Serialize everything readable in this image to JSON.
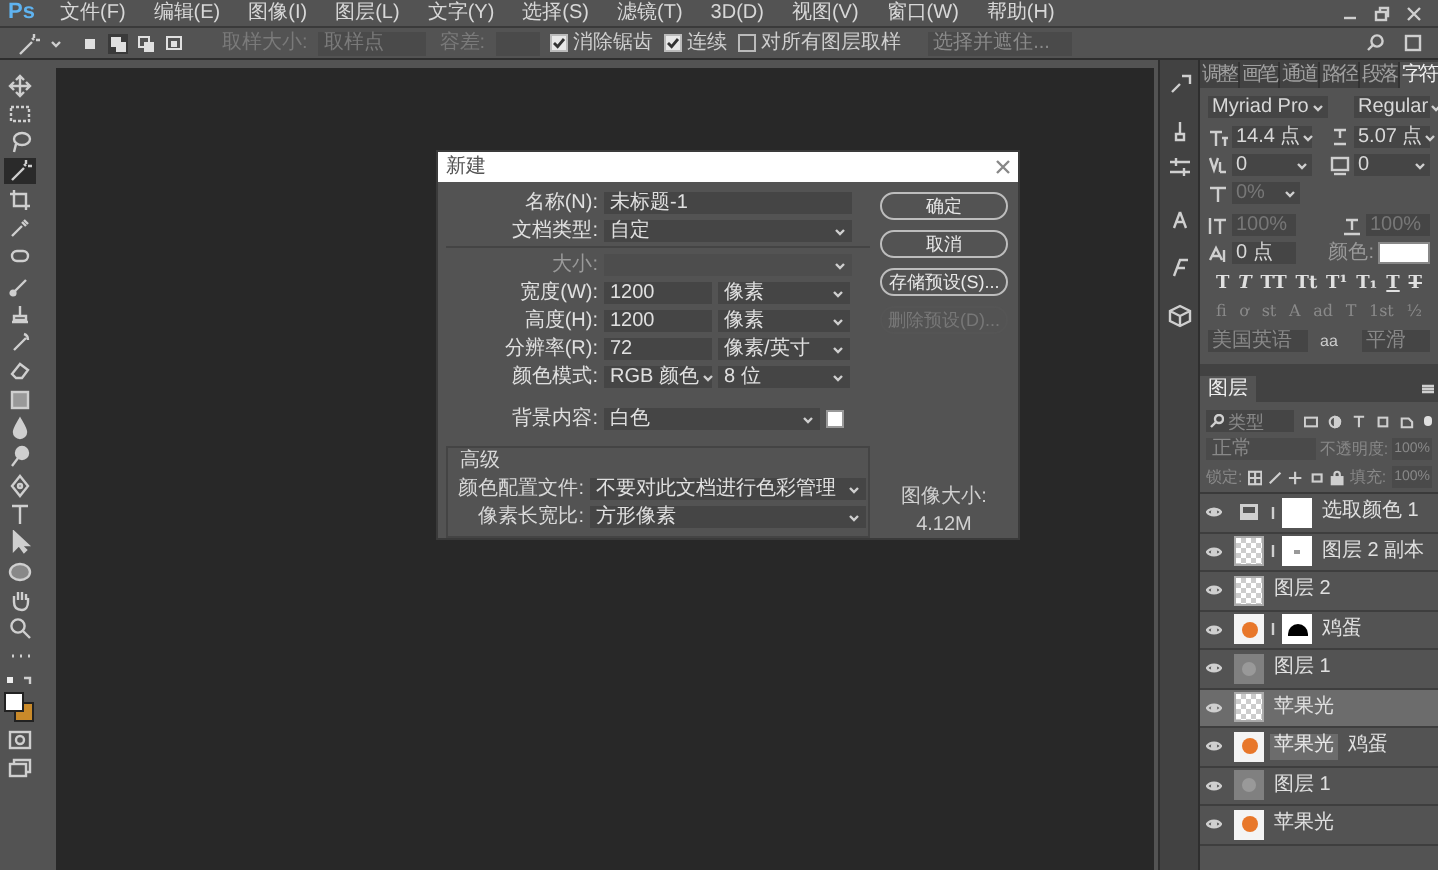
{
  "menu_bar": {
    "logo": "Ps",
    "items": [
      "文件(F)",
      "编辑(E)",
      "图像(I)",
      "图层(L)",
      "文字(Y)",
      "选择(S)",
      "滤镜(T)",
      "3D(D)",
      "视图(V)",
      "窗口(W)",
      "帮助(H)"
    ]
  },
  "options_bar": {
    "mode_buttons": [
      {
        "selected": false
      },
      {
        "selected": true
      },
      {
        "selected": false
      },
      {
        "selected": false
      }
    ],
    "sample_size_label": "取样大小:",
    "sample_size_value": "取样点",
    "tolerance_label": "容差:",
    "checkboxes": [
      {
        "label": "消除锯齿",
        "checked": true
      },
      {
        "label": "连续",
        "checked": true
      },
      {
        "label": "对所有图层取样",
        "checked": false
      }
    ],
    "refine_button": "选择并遮住..."
  },
  "toolbar": {
    "tools": [
      {
        "selected": false
      },
      {
        "selected": false
      },
      {
        "selected": false
      },
      {
        "selected": true
      },
      {
        "selected": false
      },
      {
        "selected": false
      },
      {
        "selected": false
      },
      {
        "selected": false
      },
      {
        "selected": false
      },
      {
        "selected": false
      },
      {
        "selected": false
      },
      {
        "selected": false
      },
      {
        "selected": false
      },
      {
        "selected": false
      },
      {
        "selected": false
      },
      {
        "selected": false
      },
      {
        "selected": false
      },
      {
        "selected": false
      },
      {
        "selected": false
      },
      {
        "selected": false
      },
      {
        "selected": false
      }
    ],
    "colors": [
      {
        "color": "#ffffff"
      },
      {
        "color": "#c98a2a"
      }
    ]
  },
  "dialog": {
    "title": "新建",
    "fields": [
      {
        "kind": "text",
        "label": "名称(N):",
        "value": "未标题-1",
        "disabled": false
      },
      {
        "kind": "select",
        "label": "文档类型:",
        "value": "自定",
        "disabled": false
      },
      {
        "kind": "select",
        "label": "大小:",
        "disabled": true
      },
      {
        "kind": "unit",
        "label": "宽度(W):",
        "value": "1200",
        "unit": "像素",
        "disabled": false
      },
      {
        "kind": "unit",
        "label": "高度(H):",
        "value": "1200",
        "unit": "像素",
        "disabled": false
      },
      {
        "kind": "unit",
        "label": "分辨率(R):",
        "value": "72",
        "unit": "像素/英寸",
        "disabled": false
      },
      {
        "kind": "split",
        "label": "颜色模式:",
        "value": "RGB 颜色",
        "unit": "8 位",
        "disabled": false
      },
      {
        "kind": "swatch",
        "label": "背景内容:",
        "value": "白色",
        "color": "#ffffff",
        "disabled": false
      }
    ],
    "advanced": {
      "title": "高级",
      "fields": [
        {
          "label": "颜色配置文件:",
          "value": "不要对此文档进行色彩管理"
        },
        {
          "label": "像素长宽比:",
          "value": "方形像素"
        }
      ]
    },
    "buttons": [
      {
        "label": "确定",
        "disabled": false
      },
      {
        "label": "取消",
        "disabled": false
      },
      {
        "label": "存储预设(S)...",
        "disabled": false
      },
      {
        "label": "删除预设(D)...",
        "disabled": true
      }
    ],
    "image_size": {
      "label": "图像大小:",
      "value": "4.12M"
    }
  },
  "character_panel": {
    "tabs": [
      {
        "label": "调整",
        "selected": false
      },
      {
        "label": "画笔",
        "selected": false
      },
      {
        "label": "通道",
        "selected": false
      },
      {
        "label": "路径",
        "selected": false
      },
      {
        "label": "段落",
        "selected": false
      },
      {
        "label": "字符",
        "selected": true
      }
    ],
    "font_family": "Myriad Pro",
    "font_style": "Regular",
    "size": "14.4 点",
    "leading": "5.07 点",
    "kerning": "0",
    "tracking": "0",
    "tsume": "0%",
    "vertical_scale": "100%",
    "horizontal_scale": "100%",
    "baseline_shift": "0 点",
    "color_label": "颜色:",
    "color": "#ffffff",
    "style_buttons": [
      "T",
      "T",
      "TT",
      "Tt",
      "T¹",
      "T₁",
      "T",
      "T"
    ],
    "opentype_buttons": [
      "ﬁ",
      "ơ",
      "st",
      "A",
      "ad",
      "T",
      "1st",
      "½"
    ],
    "language": "美国英语",
    "aa_label": "aa",
    "antialias": "平滑"
  },
  "layers_panel": {
    "tab": "图层",
    "search_placeholder": "类型",
    "blend_mode": "正常",
    "opacity_label": "不透明度:",
    "opacity": "100%",
    "lock_label": "锁定:",
    "fill_label": "填充:",
    "fill": "100%",
    "layers": [
      {
        "name": "选取颜色 1",
        "kind": "adjustment",
        "masked": true,
        "selected": false
      },
      {
        "name": "图层 2 副本",
        "kind": "checker",
        "masked": true,
        "selected": false
      },
      {
        "name": "图层 2",
        "kind": "checker",
        "masked": false,
        "selected": false
      },
      {
        "name": "鸡蛋",
        "kind": "orange",
        "masked": true,
        "selected": false
      },
      {
        "name": "图层 1",
        "kind": "grey",
        "masked": false,
        "selected": false
      },
      {
        "name": "苹果光",
        "kind": "checker",
        "masked": false,
        "selected": true
      },
      {
        "name": "鸡蛋",
        "kind": "orange",
        "masked": false,
        "selected": false,
        "drag_label": "苹果光"
      },
      {
        "name": "图层 1",
        "kind": "grey",
        "masked": false,
        "selected": false
      },
      {
        "name": "苹果光",
        "kind": "orange",
        "masked": false,
        "selected": false
      }
    ]
  }
}
